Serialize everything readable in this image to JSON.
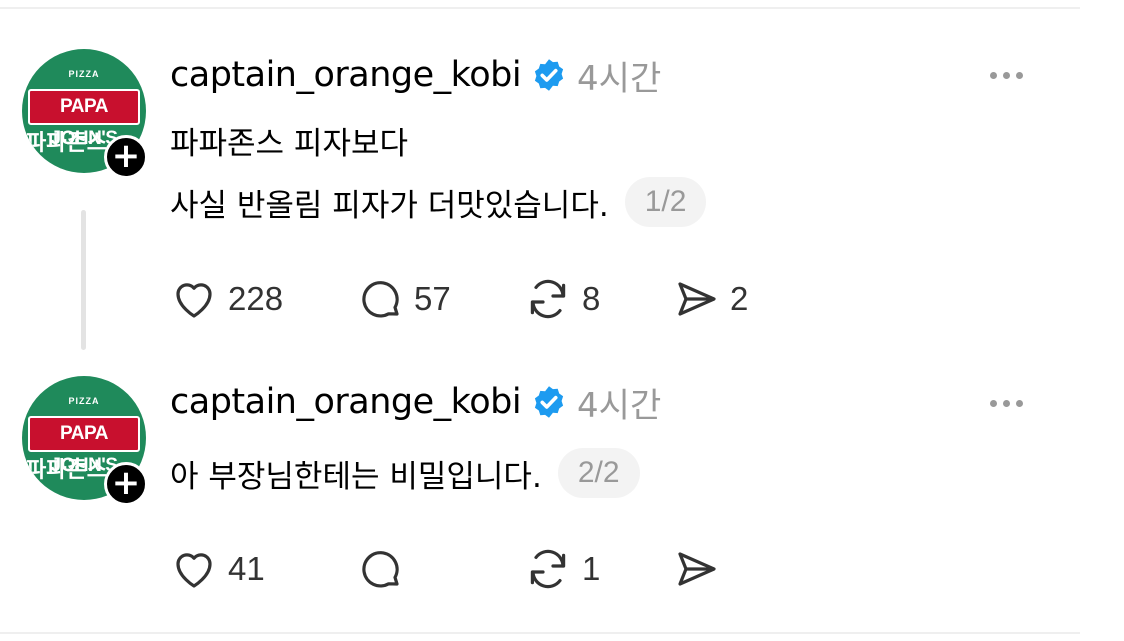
{
  "posts": [
    {
      "author": "captain_orange_kobi",
      "time": "4시간",
      "avatar_logo": {
        "top": "PIZZA",
        "brand": "PAPA JOHN'S",
        "korean": "파파존스"
      },
      "lines": [
        "파파존스 피자보다",
        "사실 반올림 피자가 더맛있습니다."
      ],
      "page": "1/2",
      "likes": "228",
      "replies": "57",
      "reposts": "8",
      "shares": "2"
    },
    {
      "author": "captain_orange_kobi",
      "time": "4시간",
      "avatar_logo": {
        "top": "PIZZA",
        "brand": "PAPA JOHN'S",
        "korean": "파파존스"
      },
      "lines": [
        "아 부장님한테는 비밀입니다."
      ],
      "page": "2/2",
      "likes": "41",
      "replies": "",
      "reposts": "1",
      "shares": ""
    }
  ],
  "icons": {
    "verified": "verified-badge-icon",
    "more": "more-options-icon",
    "like": "heart-icon",
    "reply": "comment-icon",
    "repost": "repost-icon",
    "share": "send-icon",
    "follow": "plus-icon"
  },
  "colors": {
    "verified": "#1d9bf0",
    "muted": "#999999",
    "avatar_green": "#1f8a5b",
    "brand_red": "#c8102e"
  }
}
